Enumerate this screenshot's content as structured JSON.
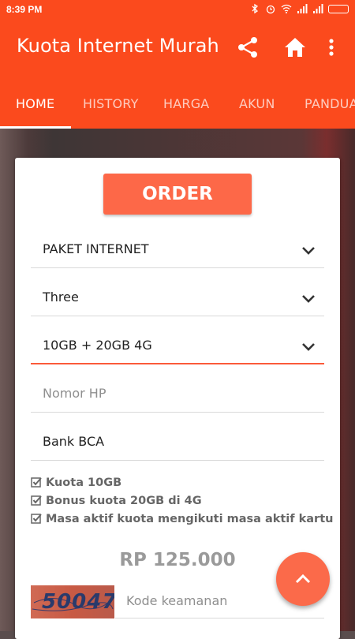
{
  "status_bar": {
    "time": "8:39 PM",
    "icons": [
      "bluetooth-icon",
      "alarm-icon",
      "wifi-icon",
      "signal-icon",
      "signal-icon",
      "battery-icon"
    ]
  },
  "toolbar": {
    "title": "Kuota Internet Murah",
    "actions": [
      "share-icon",
      "home-icon",
      "more-vert-icon"
    ]
  },
  "tabs": [
    {
      "label": "HOME",
      "active": true
    },
    {
      "label": "HISTORY",
      "active": false
    },
    {
      "label": "HARGA",
      "active": false
    },
    {
      "label": "AKUN",
      "active": false
    },
    {
      "label": "PANDUA",
      "active": false
    }
  ],
  "form": {
    "order_label": "ORDER",
    "package_type": "PAKET INTERNET",
    "provider": "Three",
    "package": "10GB + 20GB 4G",
    "phone_placeholder": "Nomor HP",
    "bank": "Bank BCA",
    "features": [
      "Kuota 10GB",
      "Bonus kuota 20GB di 4G",
      "Masa aktif kuota mengikuti masa aktif kartu"
    ],
    "price": "RP 125.000",
    "captcha_code": "50047",
    "security_placeholder": "Kode keamanan"
  },
  "colors": {
    "primary": "#fb4a1d",
    "accent": "#fd6848"
  }
}
